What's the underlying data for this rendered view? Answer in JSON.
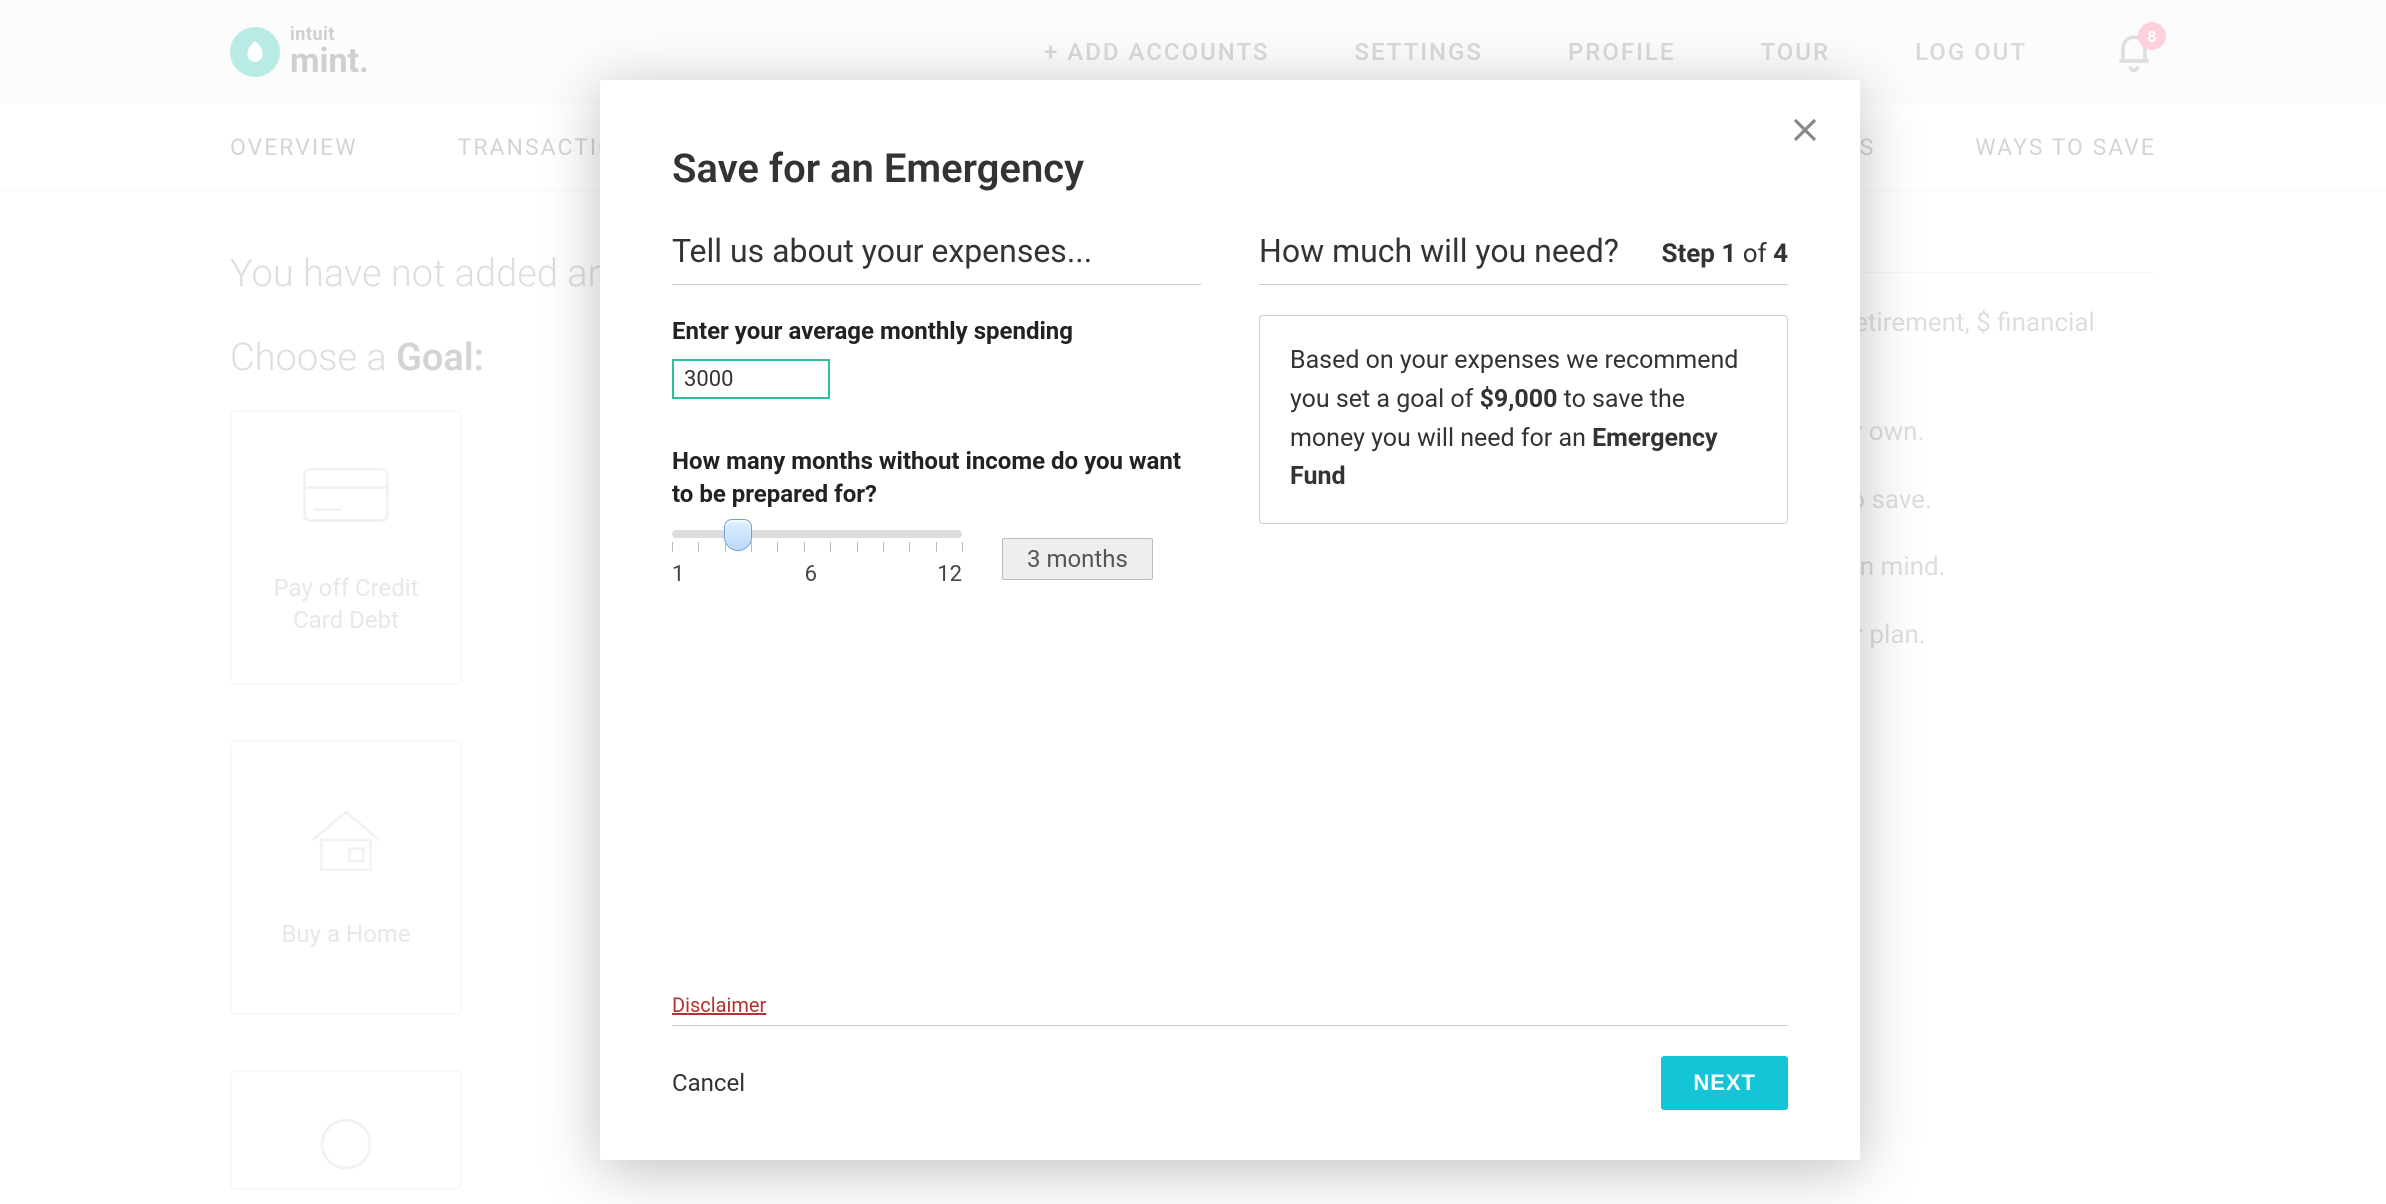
{
  "header": {
    "logo_top": "intuit",
    "logo_bottom": "mint.",
    "nav": {
      "add_accounts": "+ ADD ACCOUNTS",
      "settings": "SETTINGS",
      "profile": "PROFILE",
      "tour": "TOUR",
      "logout": "LOG OUT"
    },
    "notification_count": "8"
  },
  "subnav": {
    "overview": "OVERVIEW",
    "transactions": "TRANSACTIONS",
    "investments": "INVESTMENTS",
    "ways_to_save": "WAYS TO SAVE"
  },
  "page": {
    "intro": "You have not added any goals yet.",
    "choose_prefix": "Choose a ",
    "choose_strong": "Goal:",
    "goals": {
      "credit": "Pay off Credit Card Debt",
      "home": "Buy a Home"
    },
    "howto": {
      "p1": "to get out of debt, for retirement, $ financial goals.",
      "p2": "hoose a goal from your own.",
      "p3": "or to determine need to save.",
      "p4": "either an end date unt in mind.",
      "p5": "o an account so it's our plan."
    }
  },
  "modal": {
    "title": "Save for an Emergency",
    "step_label": "Step ",
    "step_current": "1",
    "step_of": " of ",
    "step_total": "4",
    "left_head": "Tell us about your expenses...",
    "right_head": "How much will you need?",
    "spend_label": "Enter your average monthly spending",
    "spend_value": "3000",
    "months_label": "How many months without income do you want to be prepared for?",
    "months_display": "3 months",
    "slider": {
      "min": "1",
      "mid": "6",
      "max": "12",
      "value_pct": 18
    },
    "reco_pre": "Based on your expenses we recommend you set a goal of ",
    "reco_amount": "$9,000",
    "reco_mid": " to save the money you will need for an ",
    "reco_bold": "Emergency Fund",
    "disclaimer": "Disclaimer",
    "cancel": "Cancel",
    "next": "NEXT"
  }
}
